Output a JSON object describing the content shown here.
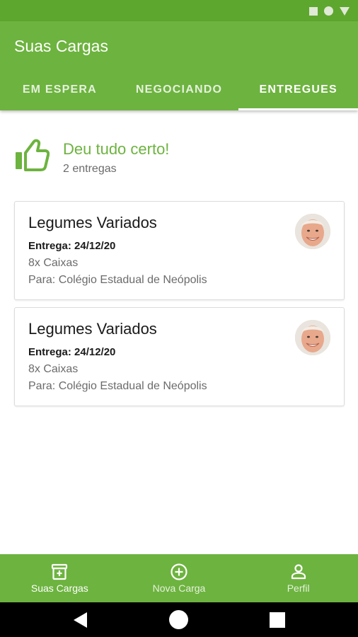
{
  "app": {
    "title": "Suas Cargas"
  },
  "tabs": [
    {
      "label": "EM ESPERA",
      "active": false
    },
    {
      "label": "NEGOCIANDO",
      "active": false
    },
    {
      "label": "ENTREGUES",
      "active": true
    }
  ],
  "summary": {
    "icon": "thumbs-up-icon",
    "title": "Deu tudo certo!",
    "count": "2 entregas"
  },
  "cards": [
    {
      "title": "Legumes Variados",
      "date": "Entrega: 24/12/20",
      "quantity": "8x Caixas",
      "destination": "Para: Colégio Estadual de Neópolis"
    },
    {
      "title": "Legumes Variados",
      "date": "Entrega: 24/12/20",
      "quantity": "8x Caixas",
      "destination": "Para: Colégio Estadual de Neópolis"
    }
  ],
  "bottom_nav": [
    {
      "label": "Suas Cargas",
      "icon": "box-icon",
      "active": true
    },
    {
      "label": "Nova Carga",
      "icon": "add-circle-icon",
      "active": false
    },
    {
      "label": "Perfil",
      "icon": "person-icon",
      "active": false
    }
  ],
  "colors": {
    "primary": "#6db33f",
    "status_bar": "#5ea72e",
    "accent_text": "#6db33f"
  }
}
